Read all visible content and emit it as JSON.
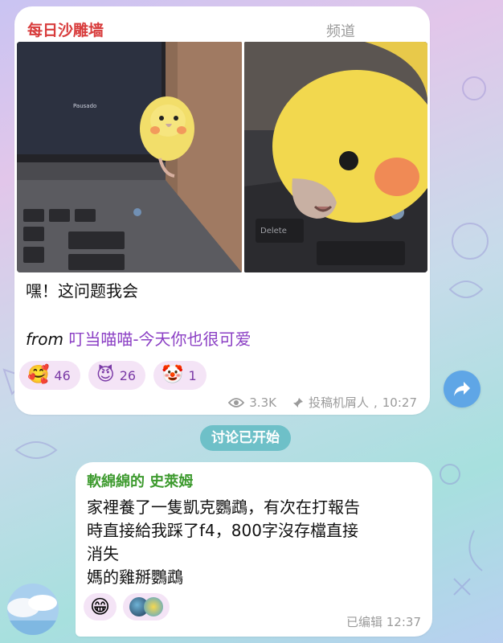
{
  "post": {
    "channel_name": "每日沙雕墙",
    "badge": "频道",
    "text": "嘿！这问题我会",
    "from_label": "from",
    "from_link": "叮当喵喵-今天你也很可爱",
    "reactions": [
      {
        "icon": "smiling-face-with-hearts-icon",
        "emoji": "🥰",
        "count": "46"
      },
      {
        "icon": "smiling-devil-icon",
        "emoji": "😈",
        "count": "26"
      },
      {
        "icon": "clown-face-icon",
        "emoji": "🤡",
        "count": "1"
      }
    ],
    "views": "3.3K",
    "author": "投稿机屑人",
    "time": "10:27",
    "photo1_screen_text": "Pausado",
    "photo2_key_text": "Delete"
  },
  "divider": "讨论已开始",
  "comment": {
    "author": "軟綿綿的 史萊姆",
    "lines": [
      "家裡養了一隻凱克鸚鵡，有次在打報告",
      "時直接給我踩了f4，800字沒存檔直接",
      "消失",
      "媽的雞掰鸚鵡"
    ],
    "reaction_emoji": "😁",
    "edited_label": "已编辑",
    "time": "12:37"
  },
  "colors": {
    "channel_name": "#d83c3c",
    "link": "#8b3fc4",
    "comment_author": "#3d9a2e",
    "divider_bg": "#6ec0c8",
    "share_button": "#5fa6e6",
    "reaction_bg": "#f4e4f6"
  }
}
